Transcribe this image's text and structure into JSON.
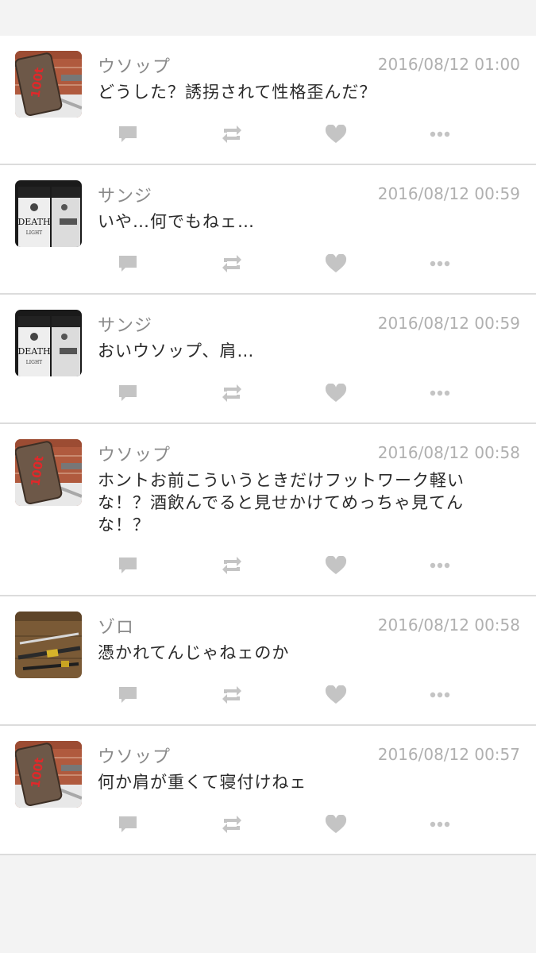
{
  "posts": [
    {
      "author": "ウソップ",
      "time": "2016/08/12 01:00",
      "text": "どうした？誘拐されて性格歪んだ？",
      "avatar_icon": "hammer-icon"
    },
    {
      "author": "サンジ",
      "time": "2016/08/12 00:59",
      "text": "いや…何でもねェ…",
      "avatar_icon": "cigarette-pack-icon"
    },
    {
      "author": "サンジ",
      "time": "2016/08/12 00:59",
      "text": "おいウソップ、肩…",
      "avatar_icon": "cigarette-pack-icon"
    },
    {
      "author": "ウソップ",
      "time": "2016/08/12 00:58",
      "text": "ホントお前こういうときだけフットワーク軽いな！？酒飲んでると見せかけてめっちゃ見てんな！？",
      "avatar_icon": "hammer-icon"
    },
    {
      "author": "ゾロ",
      "time": "2016/08/12 00:58",
      "text": "憑かれてんじゃねェのか",
      "avatar_icon": "swords-icon"
    },
    {
      "author": "ウソップ",
      "time": "2016/08/12 00:57",
      "text": "何か肩が重くて寝付けねェ",
      "avatar_icon": "hammer-icon"
    }
  ],
  "avatar_text": {
    "hammer": "100t",
    "cigarette": "DEATH",
    "cigarette_sub": "LIGHT"
  },
  "colors": {
    "icon_gray": "#c4c4c4",
    "time_gray": "#b0b0b0",
    "name_gray": "#8a8a8a"
  }
}
